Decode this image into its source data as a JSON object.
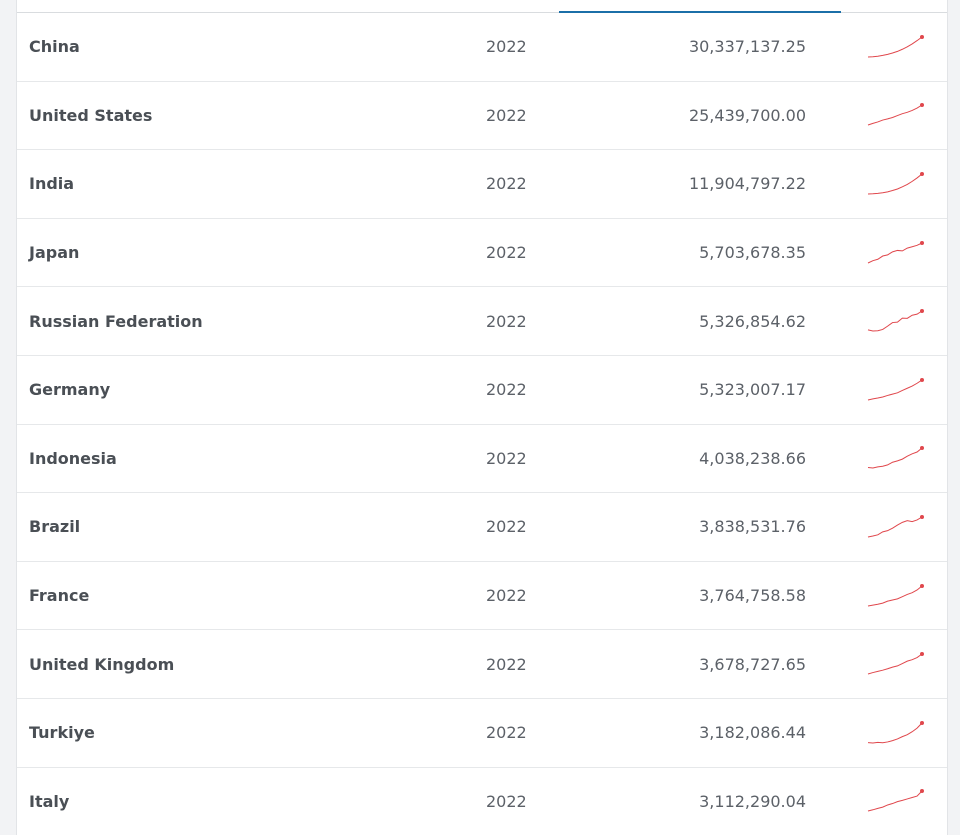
{
  "table": {
    "accent_color": "#1b6fa8",
    "sparkline_color": "#e0474c",
    "rows": [
      {
        "country": "China",
        "year": "2022",
        "value": "30,337,137.25",
        "trend": [
          1,
          1.2,
          1.6,
          2.2,
          3.0,
          4.0,
          5.2,
          6.8,
          8.6,
          10.8,
          13.3,
          16.0
        ]
      },
      {
        "country": "United States",
        "year": "2022",
        "value": "25,439,700.00",
        "trend": [
          1,
          1.7,
          2.3,
          3.1,
          3.6,
          4.2,
          5.0,
          5.8,
          6.4,
          7.2,
          8.2,
          9.5
        ]
      },
      {
        "country": "India",
        "year": "2022",
        "value": "11,904,797.22",
        "trend": [
          1,
          1.1,
          1.3,
          1.6,
          2.0,
          2.6,
          3.3,
          4.3,
          5.4,
          6.8,
          8.4,
          10.2
        ]
      },
      {
        "country": "Japan",
        "year": "2022",
        "value": "5,703,678.35",
        "trend": [
          1,
          2.0,
          2.6,
          4.0,
          4.5,
          5.8,
          6.4,
          6.2,
          7.4,
          8.0,
          8.6,
          9.6
        ]
      },
      {
        "country": "Russian Federation",
        "year": "2022",
        "value": "5,326,854.62",
        "trend": [
          1.5,
          1.0,
          1.1,
          1.7,
          3.2,
          4.8,
          5.0,
          6.8,
          6.7,
          8.1,
          8.6,
          10.0
        ]
      },
      {
        "country": "Germany",
        "year": "2022",
        "value": "5,323,007.17",
        "trend": [
          1,
          1.5,
          1.9,
          2.4,
          3.1,
          3.7,
          4.3,
          5.4,
          6.4,
          7.4,
          8.7,
          10.2
        ]
      },
      {
        "country": "Indonesia",
        "year": "2022",
        "value": "4,038,238.66",
        "trend": [
          1.2,
          1.0,
          1.5,
          1.8,
          2.4,
          3.6,
          4.2,
          5.0,
          6.3,
          7.4,
          8.2,
          10.0
        ]
      },
      {
        "country": "Brazil",
        "year": "2022",
        "value": "3,838,531.76",
        "trend": [
          1,
          1.4,
          1.9,
          3.1,
          3.6,
          4.6,
          5.9,
          7.0,
          7.7,
          7.3,
          8.0,
          9.2
        ]
      },
      {
        "country": "France",
        "year": "2022",
        "value": "3,764,758.58",
        "trend": [
          1,
          1.4,
          1.8,
          2.3,
          3.2,
          3.7,
          4.2,
          5.2,
          6.2,
          7.0,
          8.2,
          10.0
        ]
      },
      {
        "country": "United Kingdom",
        "year": "2022",
        "value": "3,678,727.65",
        "trend": [
          1,
          1.6,
          2.1,
          2.6,
          3.2,
          3.9,
          4.4,
          5.4,
          6.4,
          7.0,
          7.9,
          9.4
        ]
      },
      {
        "country": "Turkiye",
        "year": "2022",
        "value": "3,182,086.44",
        "trend": [
          1.3,
          1.1,
          1.4,
          1.2,
          1.6,
          2.2,
          3.0,
          4.1,
          5.0,
          6.4,
          8.1,
          10.5
        ]
      },
      {
        "country": "Italy",
        "year": "2022",
        "value": "3,112,290.04",
        "trend": [
          1,
          1.5,
          2.1,
          2.6,
          3.5,
          4.1,
          4.9,
          5.4,
          6.0,
          6.6,
          7.2,
          9.3
        ]
      }
    ]
  }
}
